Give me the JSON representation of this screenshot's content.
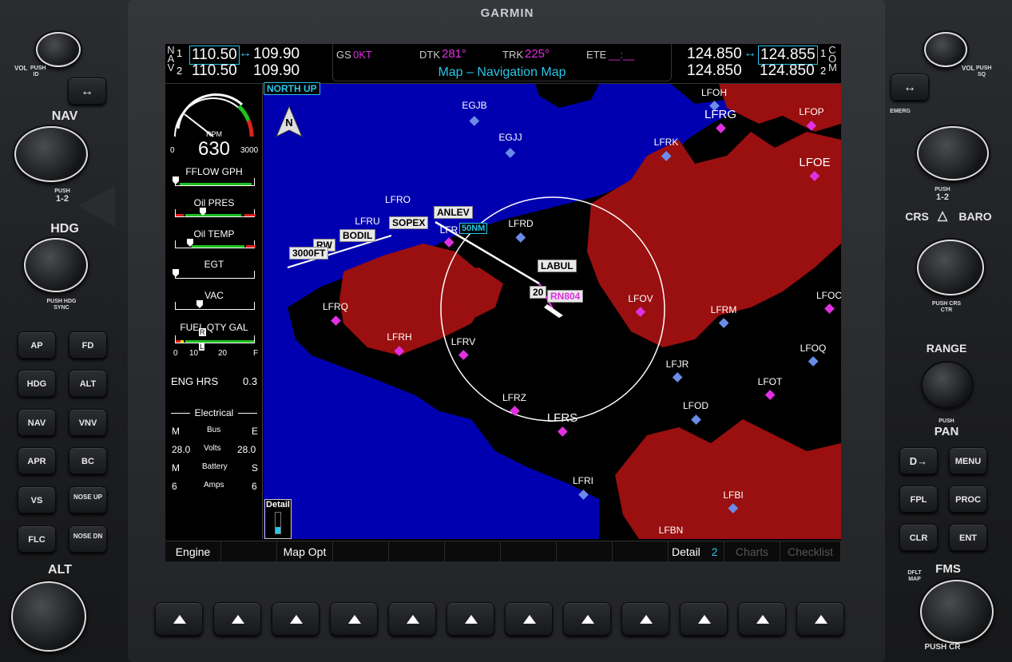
{
  "brand": "GARMIN",
  "nav": {
    "label": [
      "N",
      "A",
      "V"
    ],
    "row1_num": "1",
    "row2_num": "2",
    "nav1_active": "110.50",
    "nav1_standby": "109.90",
    "nav2_active": "110.50",
    "nav2_standby": "109.90"
  },
  "com": {
    "label": [
      "C",
      "O",
      "M"
    ],
    "row1_num": "1",
    "row2_num": "2",
    "com1_active": "124.850",
    "com1_standby": "124.855",
    "com2_active": "124.850",
    "com2_standby": "124.850"
  },
  "nav_data": {
    "gs_label": "GS",
    "gs_value": "0KT",
    "dtk_label": "DTK",
    "dtk_value": "281°",
    "trk_label": "TRK",
    "trk_value": "225°",
    "ete_label": "ETE",
    "ete_value": "__:__"
  },
  "page_title": "Map – Navigation Map",
  "map": {
    "orientation": "NORTH UP",
    "north_symbol": "N",
    "range_label": "50NM",
    "detail_label": "Detail",
    "waypoints": [
      {
        "id": "EGJB",
        "big": false
      },
      {
        "id": "EGJJ",
        "big": false
      },
      {
        "id": "LFOH",
        "big": false
      },
      {
        "id": "LFRG",
        "big": true
      },
      {
        "id": "LFOP",
        "big": false
      },
      {
        "id": "LFRK",
        "big": false
      },
      {
        "id": "LFOE",
        "big": true
      },
      {
        "id": "LFRO",
        "big": false
      },
      {
        "id": "LFRU",
        "big": false
      },
      {
        "id": "LFRD",
        "big": false
      },
      {
        "id": "LFR",
        "big": false
      },
      {
        "id": "LFOV",
        "big": false
      },
      {
        "id": "LFRM",
        "big": false
      },
      {
        "id": "LFOC",
        "big": false
      },
      {
        "id": "LFRQ",
        "big": false
      },
      {
        "id": "LFRH",
        "big": false
      },
      {
        "id": "LFRV",
        "big": false
      },
      {
        "id": "LFJR",
        "big": false
      },
      {
        "id": "LFOQ",
        "big": false
      },
      {
        "id": "LFOT",
        "big": false
      },
      {
        "id": "LFRZ",
        "big": false
      },
      {
        "id": "LFRS",
        "big": true
      },
      {
        "id": "LFOD",
        "big": false
      },
      {
        "id": "LFRI",
        "big": false
      },
      {
        "id": "LFBI",
        "big": false
      },
      {
        "id": "LFBN",
        "big": false
      }
    ],
    "tags": [
      "ANLEV",
      "SOPEX",
      "BODIL",
      "RW",
      "3000FT",
      "LABUL",
      "20",
      "RN804"
    ]
  },
  "engine": {
    "rpm_label": "RPM",
    "rpm_value": "630",
    "rpm_min": "0",
    "rpm_max": "3000",
    "fflow_label": "FFLOW GPH",
    "oilpres_label": "Oil PRES",
    "oiltemp_label": "Oil TEMP",
    "egt_label": "EGT",
    "vac_label": "VAC",
    "fuel_label": "FUEL QTY GAL",
    "fuel_ticks": [
      "0",
      "10",
      "20",
      "F"
    ],
    "fuel_l": "L",
    "fuel_r": "R",
    "eng_hrs_label": "ENG HRS",
    "eng_hrs_value": "0.3",
    "electrical_label": "Electrical",
    "bus_label": "Bus",
    "bus_m": "M",
    "bus_e": "E",
    "volts_label": "Volts",
    "volts_m": "28.0",
    "volts_e": "28.0",
    "battery_label": "Battery",
    "battery_m": "M",
    "battery_s": "S",
    "amps_label": "Amps",
    "amps_m": "6",
    "amps_s": "6"
  },
  "softkeys": [
    {
      "label": "Engine",
      "dim": false
    },
    {
      "label": "",
      "dim": false
    },
    {
      "label": "Map Opt",
      "dim": false
    },
    {
      "label": "",
      "dim": false
    },
    {
      "label": "",
      "dim": false
    },
    {
      "label": "",
      "dim": false
    },
    {
      "label": "",
      "dim": false
    },
    {
      "label": "",
      "dim": false
    },
    {
      "label": "",
      "dim": false
    },
    {
      "label": "Detail",
      "dim": false
    },
    {
      "label": "Charts",
      "dim": true
    },
    {
      "label": "Checklist",
      "dim": true
    }
  ],
  "detail_value": "2",
  "left_panel": {
    "vol_label": "VOL",
    "vol_push": "PUSH ID",
    "nav_knob": "NAV",
    "nav_push": "PUSH",
    "nav_12": "1-2",
    "hdg_knob": "HDG",
    "hdg_push": "PUSH HDG SYNC",
    "alt_knob": "ALT",
    "buttons": [
      "AP",
      "FD",
      "HDG",
      "ALT",
      "NAV",
      "VNV",
      "APR",
      "BC",
      "VS",
      "NOSE UP",
      "FLC",
      "NOSE DN"
    ]
  },
  "right_panel": {
    "vol_label": "VOL",
    "vol_push": "PUSH SQ",
    "emerg": "EMERG",
    "com_push": "PUSH",
    "com_12": "1-2",
    "crs": "CRS",
    "baro": "BARO",
    "crs_push": "PUSH CRS CTR",
    "range": "RANGE",
    "pan_push": "PUSH",
    "pan": "PAN",
    "buttons": [
      "D→",
      "MENU",
      "FPL",
      "PROC",
      "CLR",
      "ENT"
    ],
    "dfltmap": "DFLT MAP",
    "fms": "FMS",
    "fms_push": "PUSH CR"
  },
  "colors": {
    "cyan": "#29c6e8",
    "magenta": "#e030e0",
    "land": "#9a0f10",
    "water": "#0000b0"
  }
}
